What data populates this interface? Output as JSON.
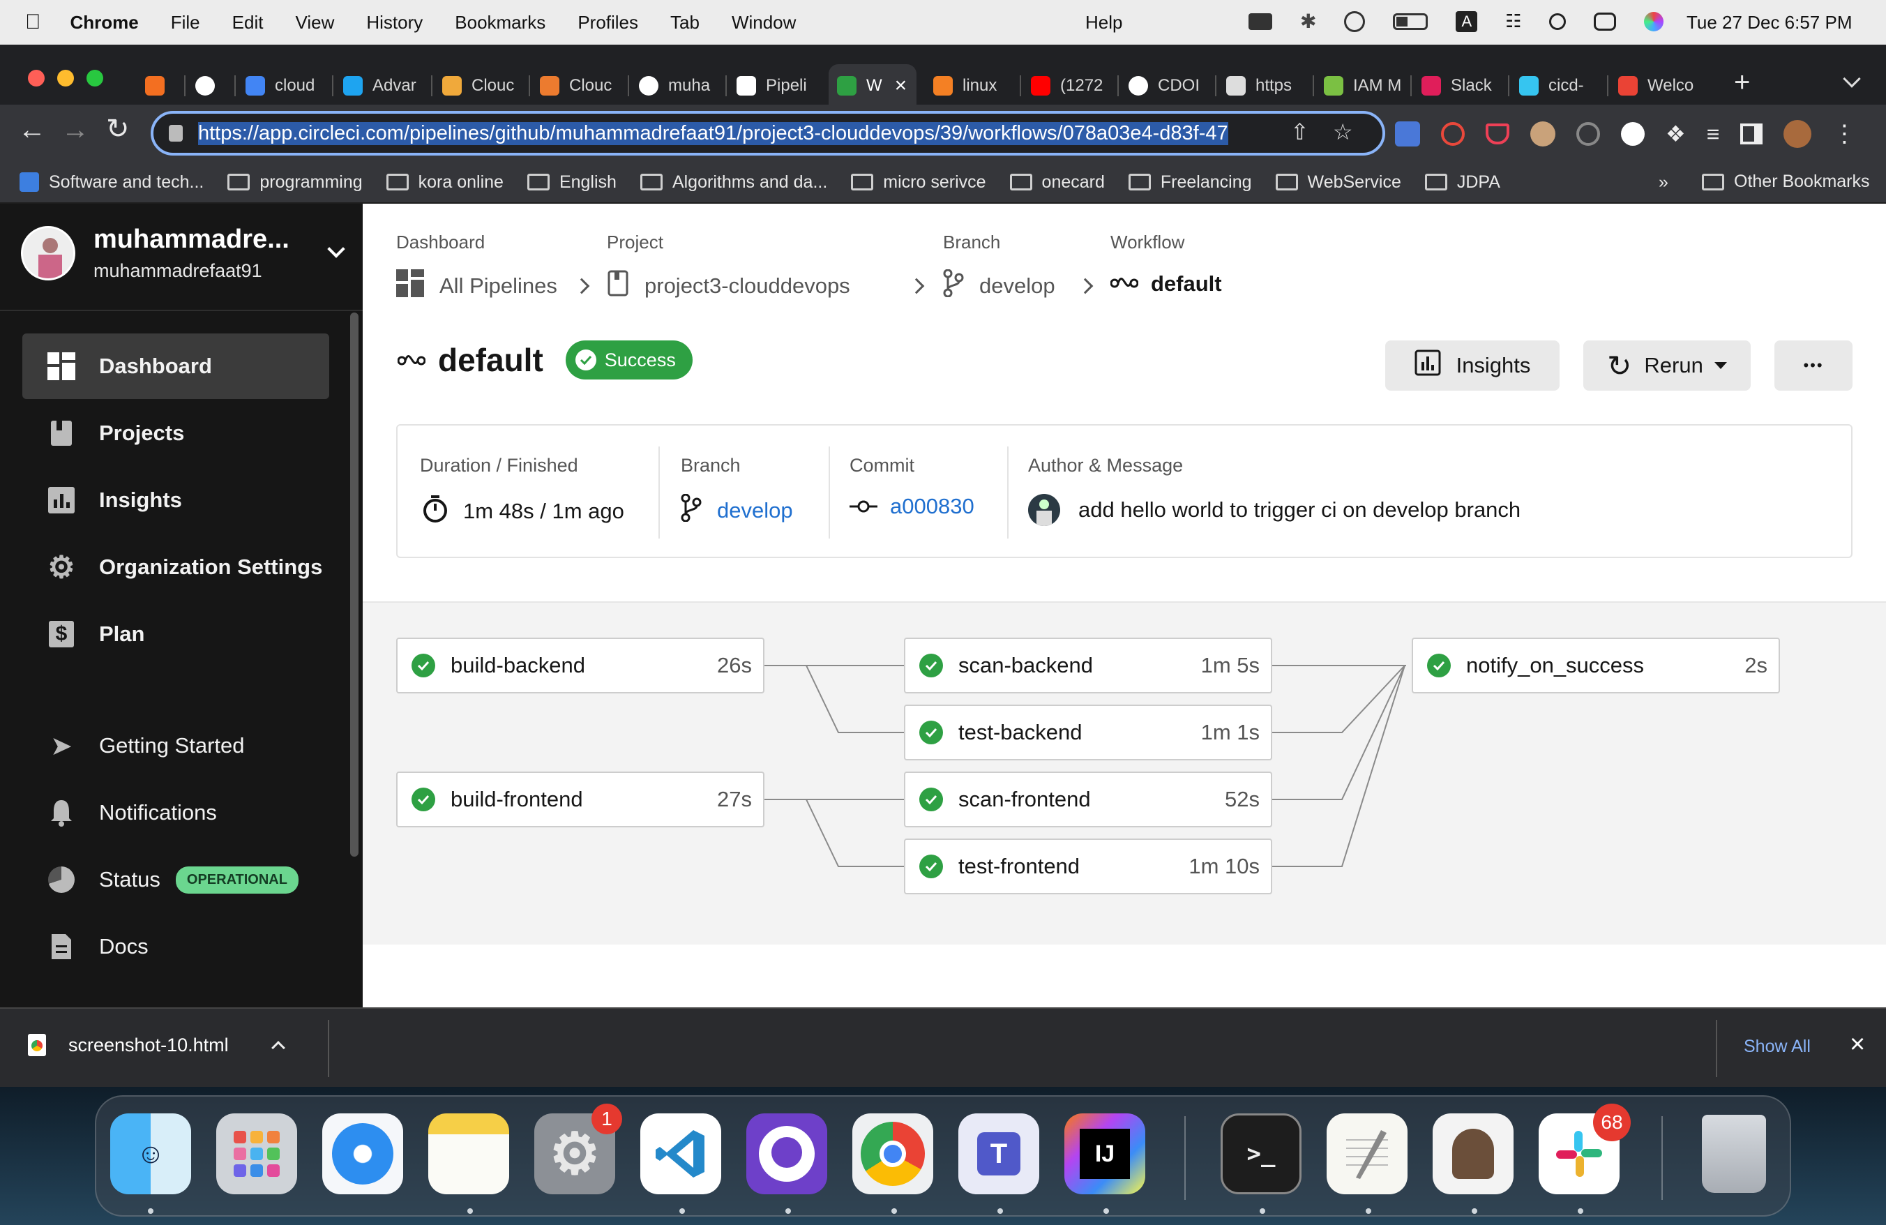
{
  "menubar": {
    "app": "Chrome",
    "items": [
      "File",
      "Edit",
      "View",
      "History",
      "Bookmarks",
      "Profiles",
      "Tab",
      "Window"
    ],
    "help": "Help",
    "clock": "Tue 27 Dec  6:57 PM",
    "input_source": "A"
  },
  "tabs": [
    {
      "title": "",
      "icon": "aws-icon",
      "color": "#f36f21"
    },
    {
      "title": "",
      "icon": "github-icon",
      "color": "#ffffff"
    },
    {
      "title": "cloud",
      "icon": "docs-icon",
      "color": "#4285f4"
    },
    {
      "title": "Advar",
      "icon": "udacity-icon",
      "color": "#1ea4f0"
    },
    {
      "title": "Clouc",
      "icon": "aws-box-icon",
      "color": "#f0a93b"
    },
    {
      "title": "Clouc",
      "icon": "aws-box-icon",
      "color": "#ec7b2f"
    },
    {
      "title": "muha",
      "icon": "github-icon",
      "color": "#ffffff"
    },
    {
      "title": "Pipeli",
      "icon": "circleci-icon",
      "color": "#ffffff"
    },
    {
      "title": "W",
      "icon": "circleci-green-icon",
      "color": "#2ea043",
      "active": true
    },
    {
      "title": "linux",
      "icon": "stackoverflow-icon",
      "color": "#f48024"
    },
    {
      "title": "(1272",
      "icon": "youtube-icon",
      "color": "#ff0000"
    },
    {
      "title": "CDOI",
      "icon": "github-icon",
      "color": "#ffffff"
    },
    {
      "title": "https",
      "icon": "k-icon",
      "color": "#dddddd"
    },
    {
      "title": "IAM M",
      "icon": "iam-icon",
      "color": "#7bc043"
    },
    {
      "title": "Slack",
      "icon": "slack-icon",
      "color": "#e01e5a"
    },
    {
      "title": "cicd-",
      "icon": "slack-icon",
      "color": "#36c5f0"
    },
    {
      "title": "Welco",
      "icon": "gmail-icon",
      "color": "#ea4335"
    }
  ],
  "address": {
    "url": "https://app.circleci.com/pipelines/github/muhammadrefaat91/project3-clouddevops/39/workflows/078a03e4-d83f-47"
  },
  "bookmarks": {
    "items": [
      "Software and tech...",
      "programming",
      "kora online",
      "English",
      "Algorithms and da...",
      "micro serivce",
      "onecard",
      "Freelancing",
      "WebService",
      "JDPA"
    ],
    "more": "»",
    "other": "Other Bookmarks"
  },
  "sidebar": {
    "user_name": "muhammadre...",
    "user_handle": "muhammadrefaat91",
    "nav": [
      {
        "label": "Dashboard",
        "icon": "dashboard-icon",
        "active": true
      },
      {
        "label": "Projects",
        "icon": "projects-icon"
      },
      {
        "label": "Insights",
        "icon": "insights-icon"
      },
      {
        "label": "Organization Settings",
        "icon": "gear-icon"
      },
      {
        "label": "Plan",
        "icon": "dollar-icon"
      }
    ],
    "secondary": [
      {
        "label": "Getting Started",
        "icon": "rocket-icon"
      },
      {
        "label": "Notifications",
        "icon": "bell-icon"
      },
      {
        "label": "Status",
        "icon": "status-icon",
        "badge": "OPERATIONAL"
      },
      {
        "label": "Docs",
        "icon": "docs-icon"
      }
    ]
  },
  "breadcrumb": {
    "headers": [
      "Dashboard",
      "Project",
      "Branch",
      "Workflow"
    ],
    "items": [
      "All Pipelines",
      "project3-clouddevops",
      "develop",
      "default"
    ]
  },
  "workflow": {
    "title": "default",
    "status": "Success",
    "insights_label": "Insights",
    "rerun_label": "Rerun",
    "more_label": "•••",
    "status_color": "#2ea043"
  },
  "info": {
    "duration_label": "Duration / Finished",
    "duration_value": "1m 48s / 1m ago",
    "branch_label": "Branch",
    "branch_value": "develop",
    "commit_label": "Commit",
    "commit_value": "a000830",
    "author_label": "Author & Message",
    "message": "add hello world to trigger ci on develop branch"
  },
  "jobs": [
    {
      "name": "build-backend",
      "duration": "26s"
    },
    {
      "name": "build-frontend",
      "duration": "27s"
    },
    {
      "name": "scan-backend",
      "duration": "1m 5s"
    },
    {
      "name": "test-backend",
      "duration": "1m 1s"
    },
    {
      "name": "scan-frontend",
      "duration": "52s"
    },
    {
      "name": "test-frontend",
      "duration": "1m 10s"
    },
    {
      "name": "notify_on_success",
      "duration": "2s"
    }
  ],
  "download": {
    "filename": "screenshot-10.html",
    "show_all": "Show All"
  },
  "dock": {
    "settings_badge": "1",
    "slack_badge": "68"
  }
}
